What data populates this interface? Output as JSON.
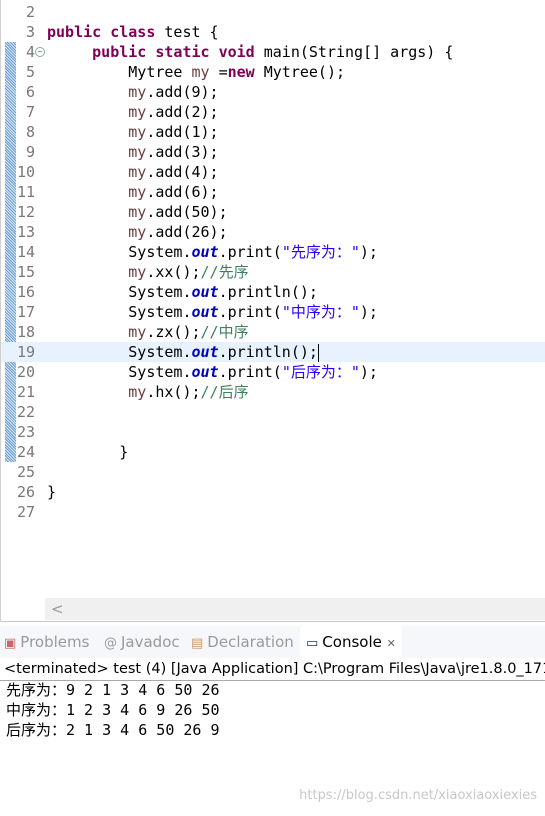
{
  "editor": {
    "lines": [
      {
        "n": "2",
        "tokens": []
      },
      {
        "n": "3",
        "tokens": [
          {
            "t": "public class",
            "c": "kw"
          },
          {
            "t": " test {"
          }
        ]
      },
      {
        "n": "4",
        "fold": true,
        "tokens": [
          {
            "t": "     "
          },
          {
            "t": "public static void",
            "c": "kw"
          },
          {
            "t": " main(String[] args) {"
          }
        ]
      },
      {
        "n": "5",
        "tokens": [
          {
            "t": "         Mytree "
          },
          {
            "t": "my",
            "c": "var"
          },
          {
            "t": " ="
          },
          {
            "t": "new",
            "c": "kw"
          },
          {
            "t": " Mytree();"
          }
        ]
      },
      {
        "n": "6",
        "tokens": [
          {
            "t": "         "
          },
          {
            "t": "my",
            "c": "var"
          },
          {
            "t": ".add(9);"
          }
        ]
      },
      {
        "n": "7",
        "tokens": [
          {
            "t": "         "
          },
          {
            "t": "my",
            "c": "var"
          },
          {
            "t": ".add(2);"
          }
        ]
      },
      {
        "n": "8",
        "tokens": [
          {
            "t": "         "
          },
          {
            "t": "my",
            "c": "var"
          },
          {
            "t": ".add(1);"
          }
        ]
      },
      {
        "n": "9",
        "tokens": [
          {
            "t": "         "
          },
          {
            "t": "my",
            "c": "var"
          },
          {
            "t": ".add(3);"
          }
        ]
      },
      {
        "n": "10",
        "tokens": [
          {
            "t": "         "
          },
          {
            "t": "my",
            "c": "var"
          },
          {
            "t": ".add(4);"
          }
        ]
      },
      {
        "n": "11",
        "tokens": [
          {
            "t": "         "
          },
          {
            "t": "my",
            "c": "var"
          },
          {
            "t": ".add(6);"
          }
        ]
      },
      {
        "n": "12",
        "tokens": [
          {
            "t": "         "
          },
          {
            "t": "my",
            "c": "var"
          },
          {
            "t": ".add(50);"
          }
        ]
      },
      {
        "n": "13",
        "tokens": [
          {
            "t": "         "
          },
          {
            "t": "my",
            "c": "var"
          },
          {
            "t": ".add(26);"
          }
        ]
      },
      {
        "n": "14",
        "tokens": [
          {
            "t": "         System."
          },
          {
            "t": "out",
            "c": "fld"
          },
          {
            "t": ".print("
          },
          {
            "t": "\"先序为：\"",
            "c": "str"
          },
          {
            "t": ");"
          }
        ]
      },
      {
        "n": "15",
        "tokens": [
          {
            "t": "         "
          },
          {
            "t": "my",
            "c": "var"
          },
          {
            "t": ".xx();"
          },
          {
            "t": "//先序",
            "c": "cmt"
          }
        ]
      },
      {
        "n": "16",
        "tokens": [
          {
            "t": "         System."
          },
          {
            "t": "out",
            "c": "fld"
          },
          {
            "t": ".println();"
          }
        ]
      },
      {
        "n": "17",
        "tokens": [
          {
            "t": "         System."
          },
          {
            "t": "out",
            "c": "fld"
          },
          {
            "t": ".print("
          },
          {
            "t": "\"中序为：\"",
            "c": "str"
          },
          {
            "t": ");"
          }
        ]
      },
      {
        "n": "18",
        "tokens": [
          {
            "t": "         "
          },
          {
            "t": "my",
            "c": "var"
          },
          {
            "t": ".zx();"
          },
          {
            "t": "//中序",
            "c": "cmt"
          }
        ]
      },
      {
        "n": "19",
        "current": true,
        "tokens": [
          {
            "t": "         System."
          },
          {
            "t": "out",
            "c": "fld"
          },
          {
            "t": ".println();"
          }
        ]
      },
      {
        "n": "20",
        "tokens": [
          {
            "t": "         System."
          },
          {
            "t": "out",
            "c": "fld"
          },
          {
            "t": ".print("
          },
          {
            "t": "\"后序为：\"",
            "c": "str"
          },
          {
            "t": ");"
          }
        ]
      },
      {
        "n": "21",
        "tokens": [
          {
            "t": "         "
          },
          {
            "t": "my",
            "c": "var"
          },
          {
            "t": ".hx();"
          },
          {
            "t": "//后序",
            "c": "cmt"
          }
        ]
      },
      {
        "n": "22",
        "tokens": []
      },
      {
        "n": "23",
        "tokens": []
      },
      {
        "n": "24",
        "tokens": [
          {
            "t": "        }"
          }
        ]
      },
      {
        "n": "25",
        "tokens": []
      },
      {
        "n": "26",
        "tokens": [
          {
            "t": "}"
          }
        ]
      },
      {
        "n": "27",
        "tokens": []
      }
    ],
    "scroll_left": "<"
  },
  "tabs": [
    {
      "label": "Problems",
      "icon": "problems-icon",
      "glyph": "▣"
    },
    {
      "label": "Javadoc",
      "icon": "javadoc-icon",
      "glyph": "@"
    },
    {
      "label": "Declaration",
      "icon": "declaration-icon",
      "glyph": "▤"
    },
    {
      "label": "Console",
      "icon": "console-icon",
      "glyph": "▭",
      "active": true
    }
  ],
  "console": {
    "close": "✕",
    "header": "<terminated> test (4) [Java Application] C:\\Program Files\\Java\\jre1.8.0_171",
    "output": [
      "先序为：9 2 1 3 4 6 50 26",
      "中序为：1 2 3 4 6 9 26 50",
      "后序为：2 1 3 4 6 50 26 9"
    ]
  },
  "watermark": "https://blog.csdn.net/xiaoxiaoxiexies"
}
